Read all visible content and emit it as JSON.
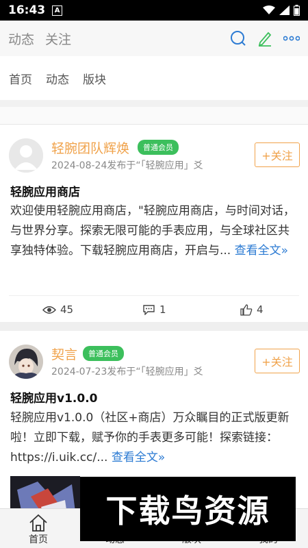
{
  "status": {
    "time": "16:43",
    "notif_badge": "A"
  },
  "topbar": {
    "tabs": [
      "动态",
      "关注"
    ]
  },
  "subnav": {
    "items": [
      "首页",
      "动态",
      "版块"
    ]
  },
  "posts": [
    {
      "author": "轻腕团队辉焕",
      "badge": "普通会员",
      "meta": "2024-08-24发布于“「轻腕应用」爻",
      "follow": "+关注",
      "title": "轻腕应用商店",
      "body": "欢迎使用轻腕应用商店，\"轻腕应用商店，与时间对话，与世界分享。探索无限可能的手表应用，与全球社区共享独特体验。下载轻腕应用商店，开启与...",
      "more": "查看全文»",
      "views": "45",
      "comments": "1",
      "likes": "4"
    },
    {
      "author": "契言",
      "badge": "普通会员",
      "meta": "2024-07-23发布于“「轻腕应用」爻",
      "follow": "+关注",
      "title": "轻腕应用v1.0.0",
      "body": "轻腕应用v1.0.0（社区+商店）万众瞩目的正式版更新啦！立即下载，赋予你的手表更多可能！探索链接：https://i.uik.cc/...",
      "more": "查看全文»"
    }
  ],
  "bottomnav": {
    "items": [
      "首页",
      "动态",
      "版块",
      "我的"
    ]
  },
  "watermark": "下载鸟资源",
  "colors": {
    "accent": "#f0a24a",
    "badge": "#3cbf5c",
    "link": "#2c7bd3"
  }
}
